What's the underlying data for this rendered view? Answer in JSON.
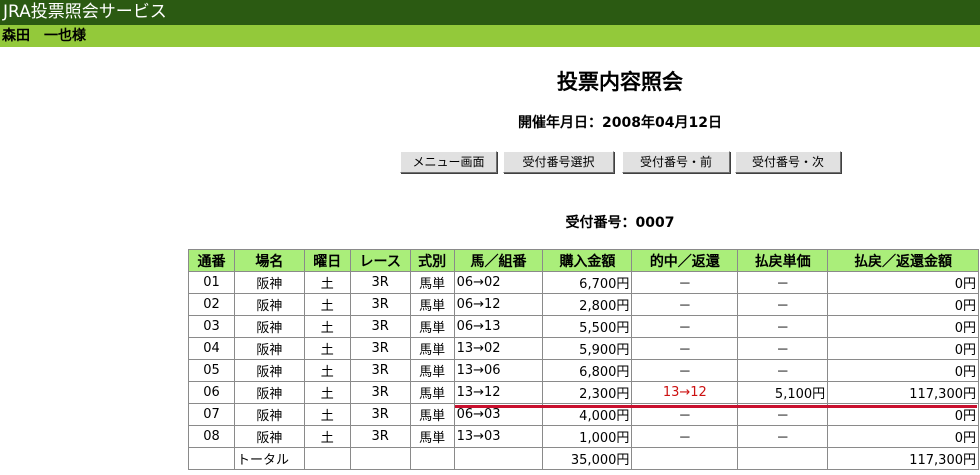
{
  "app": {
    "title": "JRA投票照会サービス",
    "user": "森田　一也様"
  },
  "page": {
    "heading": "投票内容照会",
    "date_label": "開催年月日：",
    "date_value": "2008年04月12日",
    "receipt_label": "受付番号：",
    "receipt_value": "0007"
  },
  "buttons": {
    "menu": "メニュー画面",
    "select": "受付番号選択",
    "prev": "受付番号・前",
    "next": "受付番号・次"
  },
  "table": {
    "headers": {
      "seq": "通番",
      "venue": "場名",
      "day": "曜日",
      "race": "レース",
      "bet_type": "式別",
      "combo": "馬／組番",
      "amount": "購入金額",
      "hit_refund": "的中／返還",
      "unit_payout": "払戻単価",
      "payout_amount": "払戻／返還金額"
    },
    "rows": [
      {
        "seq": "01",
        "venue": "阪神",
        "day": "土",
        "race": "3R",
        "bet_type": "馬単",
        "combo": "06→02",
        "amount": "6,700円",
        "hit": "－",
        "unit": "－",
        "payout": "0円"
      },
      {
        "seq": "02",
        "venue": "阪神",
        "day": "土",
        "race": "3R",
        "bet_type": "馬単",
        "combo": "06→12",
        "amount": "2,800円",
        "hit": "－",
        "unit": "－",
        "payout": "0円"
      },
      {
        "seq": "03",
        "venue": "阪神",
        "day": "土",
        "race": "3R",
        "bet_type": "馬単",
        "combo": "06→13",
        "amount": "5,500円",
        "hit": "－",
        "unit": "－",
        "payout": "0円"
      },
      {
        "seq": "04",
        "venue": "阪神",
        "day": "土",
        "race": "3R",
        "bet_type": "馬単",
        "combo": "13→02",
        "amount": "5,900円",
        "hit": "－",
        "unit": "－",
        "payout": "0円"
      },
      {
        "seq": "05",
        "venue": "阪神",
        "day": "土",
        "race": "3R",
        "bet_type": "馬単",
        "combo": "13→06",
        "amount": "6,800円",
        "hit": "－",
        "unit": "－",
        "payout": "0円"
      },
      {
        "seq": "06",
        "venue": "阪神",
        "day": "土",
        "race": "3R",
        "bet_type": "馬単",
        "combo": "13→12",
        "amount": "2,300円",
        "hit": "13→12",
        "unit": "5,100円",
        "payout": "117,300円"
      },
      {
        "seq": "07",
        "venue": "阪神",
        "day": "土",
        "race": "3R",
        "bet_type": "馬単",
        "combo": "06→03",
        "amount": "4,000円",
        "hit": "－",
        "unit": "－",
        "payout": "0円"
      },
      {
        "seq": "08",
        "venue": "阪神",
        "day": "土",
        "race": "3R",
        "bet_type": "馬単",
        "combo": "13→03",
        "amount": "1,000円",
        "hit": "－",
        "unit": "－",
        "payout": "0円"
      }
    ],
    "total": {
      "label": "トータル",
      "amount": "35,000円",
      "payout": "117,300円"
    }
  },
  "colors": {
    "title_bar": "#2b5a12",
    "user_bar": "#93c93a",
    "header_bg": "#aaee7a",
    "hit_text": "#cc1111",
    "hit_underline": "#c8102e"
  }
}
